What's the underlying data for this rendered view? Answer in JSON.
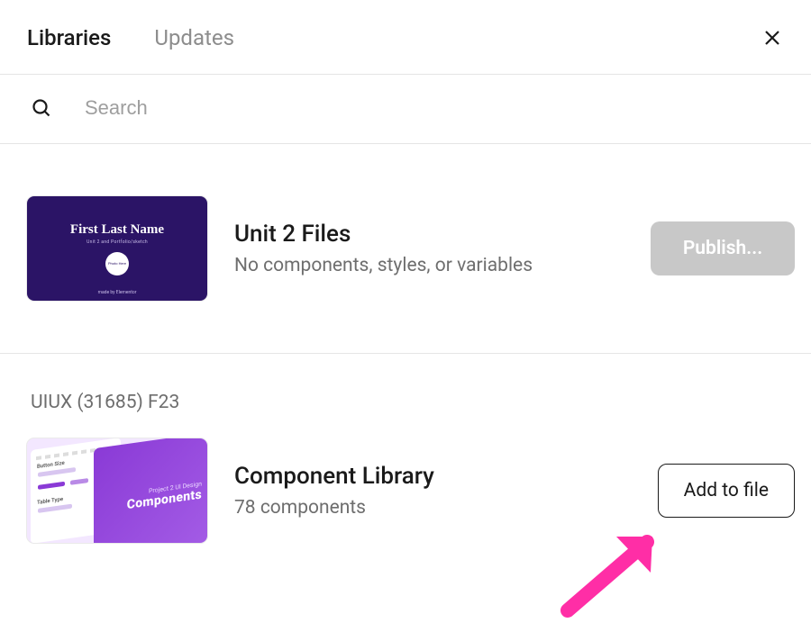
{
  "header": {
    "tab_libraries": "Libraries",
    "tab_updates": "Updates"
  },
  "search": {
    "placeholder": "Search",
    "value": ""
  },
  "current_file": {
    "title": "Unit 2 Files",
    "subtitle": "No components, styles, or variables",
    "publish_label": "Publish...",
    "thumb": {
      "name": "First Last Name",
      "sub": "Unit 2 and Portfolio/sketch",
      "avatar": "Photo Here",
      "footer": "made by Elementor"
    }
  },
  "section_label": "UIUX (31685) F23",
  "library": {
    "title": "Component Library",
    "subtitle": "78 components",
    "add_label": "Add to file",
    "thumb": {
      "small": "Project 2 UI Design",
      "big": "Components",
      "button_label": "Button Size",
      "table_label": "Table Type"
    }
  }
}
